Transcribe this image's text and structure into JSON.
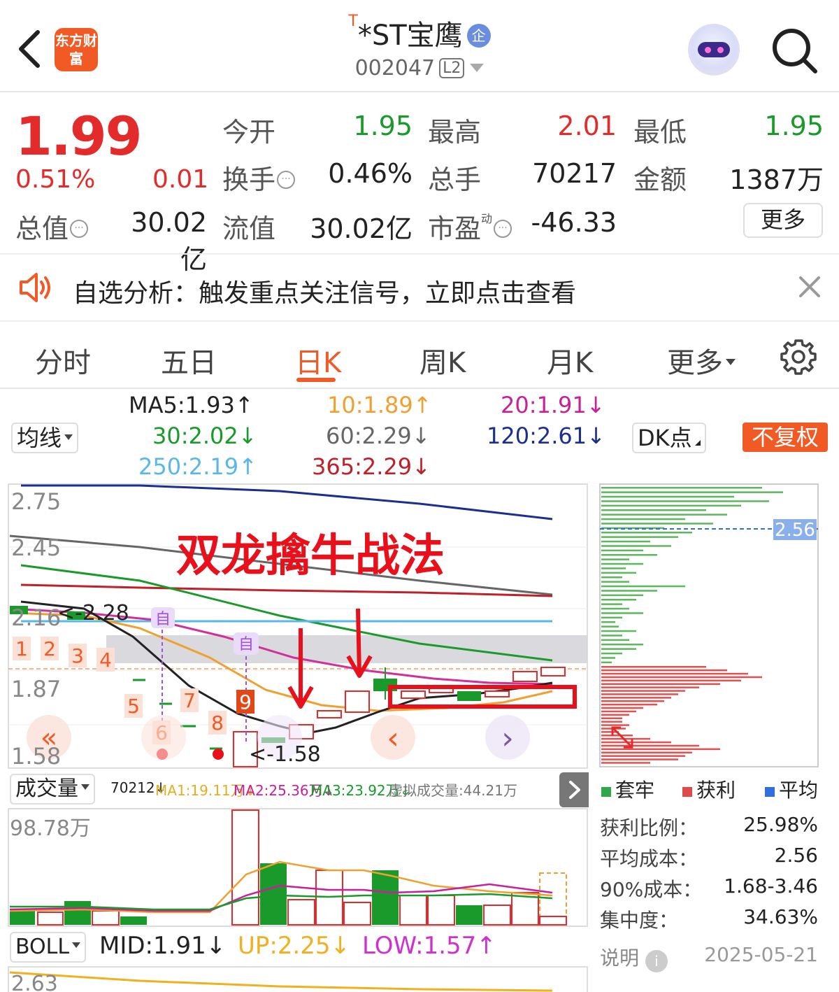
{
  "header": {
    "logo_text": "东方财富",
    "title_tag": "T",
    "title": "*ST宝鹰",
    "badge": "企",
    "code": "002047",
    "level": "L2"
  },
  "quote": {
    "price": "1.99",
    "change_pct": "0.51%",
    "change": "0.01",
    "fields": {
      "open_label": "今开",
      "open": "1.95",
      "high_label": "最高",
      "high": "2.01",
      "low_label": "最低",
      "low": "1.95",
      "turnover_label": "换手",
      "turnover": "0.46%",
      "volume_label": "总手",
      "volume": "70217",
      "amount_label": "金额",
      "amount": "1387万",
      "mktcap_label": "总值",
      "mktcap": "30.02亿",
      "float_label": "流值",
      "float_cap": "30.02亿",
      "pe_label": "市盈",
      "pe_sup": "动",
      "pe": "-46.33"
    },
    "more_label": "更多"
  },
  "notice": {
    "text": "自选分析：触发重点关注信号，立即点击查看"
  },
  "tabs": [
    {
      "label": "分时"
    },
    {
      "label": "五日"
    },
    {
      "label": "日K"
    },
    {
      "label": "周K"
    },
    {
      "label": "月K"
    },
    {
      "label": "更多"
    }
  ],
  "ma_legend": {
    "selector": "均线",
    "ma5": "MA5:1.93↑",
    "ma10": "10:1.89↑",
    "ma20": "20:1.91↓",
    "ma30": "30:2.02↓",
    "ma60": "60:2.29↓",
    "ma120": "120:2.61↓",
    "ma250": "250:2.19↑",
    "ma365": "365:2.29↓",
    "dk_label": "DK点",
    "fq_label": "不复权"
  },
  "colors": {
    "up": "#e32b2b",
    "down": "#1a9a2a",
    "accent": "#f15a24",
    "ma5": "#222222",
    "ma10": "#f0a030",
    "ma20": "#d0309a",
    "ma30": "#1a9a2a",
    "ma60": "#666666",
    "ma120": "#1a2f8f",
    "ma250": "#5ab8e8",
    "ma365": "#c0202a"
  },
  "kline": {
    "y_ticks": [
      "2.75",
      "2.45",
      "2.16",
      "1.87",
      "1.58"
    ],
    "max_label": "<-2.28",
    "min_label": "<-1.58",
    "annotation": "双龙擒牛战法",
    "markers": [
      "1",
      "2",
      "3",
      "4",
      "5",
      "6",
      "7",
      "8",
      "9"
    ],
    "self_marks": [
      "自",
      "自"
    ],
    "nav_left_fast": "«",
    "nav_prev": "‹",
    "nav_next": "›"
  },
  "cyq": {
    "avg_label": "2.56",
    "legend": [
      "套牢",
      "获利",
      "平均"
    ],
    "rows": [
      {
        "label": "获利比例：",
        "value": "25.98%"
      },
      {
        "label": "平均成本：",
        "value": "2.56"
      },
      {
        "label": "90%成本：",
        "value": "1.68-3.46"
      },
      {
        "label": "集中度：",
        "value": "34.63%"
      }
    ],
    "note_label": "说明",
    "date": "2025-05-21"
  },
  "volume": {
    "selector": "成交量",
    "v": "70212↓",
    "ma1": "MA1:19.11万↓",
    "ma2": "MA2:25.36万↓",
    "ma3": "MA3:23.92万↓",
    "virtual": "虚拟成交量:44.21万",
    "max_label": "98.78万"
  },
  "boll": {
    "selector": "BOLL",
    "mid": "MID:1.91↓",
    "up": "UP:2.25↓",
    "low": "LOW:1.57↑",
    "top_label": "2.63"
  }
}
